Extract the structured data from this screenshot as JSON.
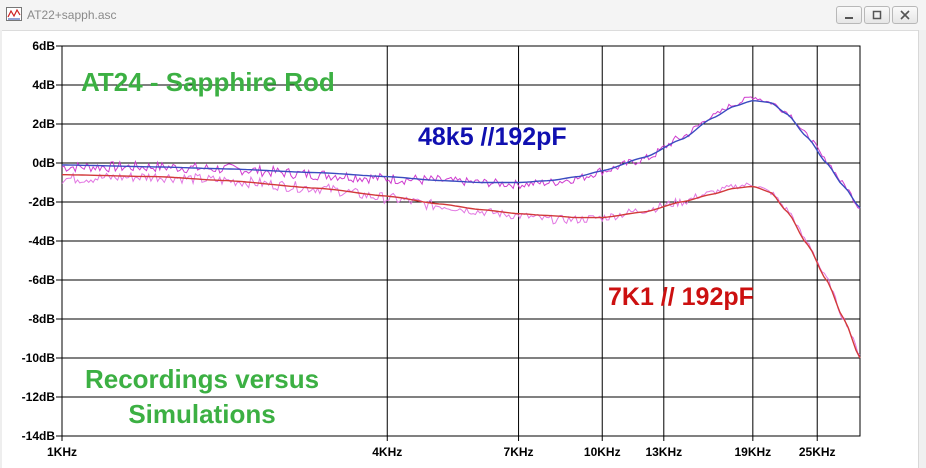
{
  "window": {
    "title": "AT22+sapph.asc"
  },
  "colors": {
    "title_green": "#3cb043",
    "label_blue": "#1010b0",
    "label_red": "#cc1010",
    "series_blue": "#3a4cc0",
    "series_red": "#d23a3a",
    "recording_magenta": "#cc33cc",
    "recording_pink": "#e070e0"
  },
  "chart_data": {
    "type": "line",
    "title": "AT24 - Sapphire Rod",
    "annotation": "Recordings versus Simulations",
    "x_scale": "log",
    "xlim_hz": [
      1000,
      30000
    ],
    "ylim": [
      -14,
      6
    ],
    "grid": true,
    "y_ticks": [
      {
        "value": 6,
        "label": "6dB"
      },
      {
        "value": 4,
        "label": "4dB"
      },
      {
        "value": 2,
        "label": "2dB"
      },
      {
        "value": 0,
        "label": "0dB"
      },
      {
        "value": -2,
        "label": "-2dB"
      },
      {
        "value": -4,
        "label": "-4dB"
      },
      {
        "value": -6,
        "label": "-6dB"
      },
      {
        "value": -8,
        "label": "-8dB"
      },
      {
        "value": -10,
        "label": "-10dB"
      },
      {
        "value": -12,
        "label": "-12dB"
      },
      {
        "value": -14,
        "label": "-14dB"
      }
    ],
    "x_ticks": [
      {
        "value": 1000,
        "label": "1KHz"
      },
      {
        "value": 4000,
        "label": "4KHz"
      },
      {
        "value": 7000,
        "label": "7KHz"
      },
      {
        "value": 10000,
        "label": "10KHz"
      },
      {
        "value": 13000,
        "label": "13KHz"
      },
      {
        "value": 19000,
        "label": "19KHz"
      },
      {
        "value": 25000,
        "label": "25KHz"
      }
    ],
    "series": [
      {
        "name": "48k5 //192pF",
        "color": "#1010b0",
        "simulation": [
          [
            1000,
            -0.1
          ],
          [
            1500,
            -0.2
          ],
          [
            2000,
            -0.3
          ],
          [
            3000,
            -0.5
          ],
          [
            4000,
            -0.7
          ],
          [
            5000,
            -0.9
          ],
          [
            6000,
            -1.0
          ],
          [
            7000,
            -1.0
          ],
          [
            8000,
            -0.9
          ],
          [
            9000,
            -0.7
          ],
          [
            10000,
            -0.4
          ],
          [
            12000,
            0.3
          ],
          [
            14000,
            1.2
          ],
          [
            16000,
            2.3
          ],
          [
            17500,
            2.9
          ],
          [
            19000,
            3.2
          ],
          [
            20500,
            3.1
          ],
          [
            22000,
            2.5
          ],
          [
            24000,
            1.3
          ],
          [
            26000,
            0.0
          ],
          [
            28000,
            -1.2
          ],
          [
            30000,
            -2.3
          ]
        ],
        "recording": [
          [
            1000,
            -0.2
          ],
          [
            1500,
            -0.2
          ],
          [
            2000,
            -0.3
          ],
          [
            3000,
            -0.6
          ],
          [
            4000,
            -0.8
          ],
          [
            5000,
            -0.9
          ],
          [
            6000,
            -1.0
          ],
          [
            7000,
            -1.1
          ],
          [
            8000,
            -1.0
          ],
          [
            9000,
            -0.8
          ],
          [
            10000,
            -0.4
          ],
          [
            12000,
            0.2
          ],
          [
            14000,
            1.3
          ],
          [
            16000,
            2.4
          ],
          [
            17500,
            3.0
          ],
          [
            19000,
            3.4
          ],
          [
            20500,
            3.1
          ],
          [
            22000,
            2.6
          ],
          [
            24000,
            1.4
          ],
          [
            26000,
            0.1
          ],
          [
            28000,
            -1.1
          ],
          [
            30000,
            -2.3
          ]
        ]
      },
      {
        "name": "7K1 // 192pF",
        "color": "#cc1010",
        "simulation": [
          [
            1000,
            -0.6
          ],
          [
            1500,
            -0.7
          ],
          [
            2000,
            -0.9
          ],
          [
            3000,
            -1.3
          ],
          [
            4000,
            -1.7
          ],
          [
            5000,
            -2.1
          ],
          [
            6000,
            -2.4
          ],
          [
            7000,
            -2.6
          ],
          [
            8000,
            -2.7
          ],
          [
            9000,
            -2.8
          ],
          [
            10000,
            -2.8
          ],
          [
            12000,
            -2.5
          ],
          [
            14000,
            -2.0
          ],
          [
            16000,
            -1.6
          ],
          [
            17500,
            -1.3
          ],
          [
            19000,
            -1.2
          ],
          [
            20500,
            -1.5
          ],
          [
            22000,
            -2.5
          ],
          [
            24000,
            -4.2
          ],
          [
            26000,
            -6.0
          ],
          [
            28000,
            -8.0
          ],
          [
            30000,
            -10.0
          ]
        ],
        "recording": [
          [
            1000,
            -0.8
          ],
          [
            1500,
            -0.7
          ],
          [
            2000,
            -0.9
          ],
          [
            3000,
            -1.3
          ],
          [
            4000,
            -1.8
          ],
          [
            5000,
            -2.2
          ],
          [
            6000,
            -2.5
          ],
          [
            7000,
            -2.7
          ],
          [
            8000,
            -2.9
          ],
          [
            9000,
            -2.9
          ],
          [
            10000,
            -2.8
          ],
          [
            12000,
            -2.4
          ],
          [
            14000,
            -2.0
          ],
          [
            16000,
            -1.5
          ],
          [
            17500,
            -1.2
          ],
          [
            19000,
            -1.1
          ],
          [
            20500,
            -1.5
          ],
          [
            22000,
            -2.4
          ],
          [
            24000,
            -4.1
          ],
          [
            26000,
            -5.9
          ],
          [
            28000,
            -8.0
          ],
          [
            30000,
            -9.8
          ]
        ]
      }
    ]
  }
}
